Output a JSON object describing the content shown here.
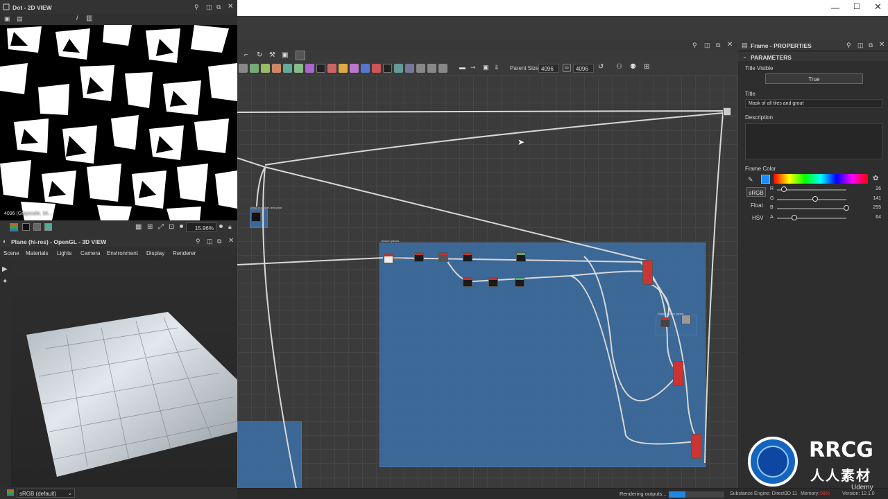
{
  "left_top": {
    "title": "Dot - 2D VIEW",
    "status_text": "4096 (Grayscale, 16...",
    "zoom": "15.96%"
  },
  "left_bottom": {
    "title": "Plane (hi-res) - OpenGL - 3D VIEW",
    "menu": [
      "Scene",
      "Materials",
      "Lights",
      "Camera",
      "Environment",
      "Display",
      "Renderer"
    ],
    "colorspace": "sRGB (default)"
  },
  "graph": {
    "parent_size_label": "Parent Size:",
    "parent_size": "4096",
    "size_value": "4096",
    "frame_small_title": "Mask of all tiles and grout",
    "frame_main_title": "Broken pieces",
    "frame_sub_title": "Rotate broken pieces"
  },
  "properties": {
    "title": "Frame - PROPERTIES",
    "section": "PARAMETERS",
    "title_visible_label": "Title Visible",
    "title_visible_value": "True",
    "title_label": "Title",
    "title_value": "Mask of all tiles and grout",
    "description_label": "Description",
    "frame_color_label": "Frame Color",
    "srgb_button": "sRGB",
    "float_button": "Float",
    "hsv_button": "HSV",
    "channels": [
      {
        "label": "R",
        "value": "26",
        "fraction": 0.1
      },
      {
        "label": "G",
        "value": "141",
        "fraction": 0.55
      },
      {
        "label": "B",
        "value": "255",
        "fraction": 1.0
      },
      {
        "label": "A",
        "value": "64",
        "fraction": 0.25
      }
    ],
    "frame_color_hex": "#1a8dff"
  },
  "status_bar": {
    "rendering": "Rendering outputs...",
    "engine": "Substance Engine: Direct3D 11",
    "memory_label": "Memory:",
    "memory_value": "98%",
    "version": "Version: 12.1.0"
  },
  "watermark": {
    "brand": "RRCG",
    "sub": "人人素材",
    "udemy": "Udemy"
  },
  "colors": {
    "frame_blue": "#3d6b9c",
    "accent": "#1a8dff"
  }
}
